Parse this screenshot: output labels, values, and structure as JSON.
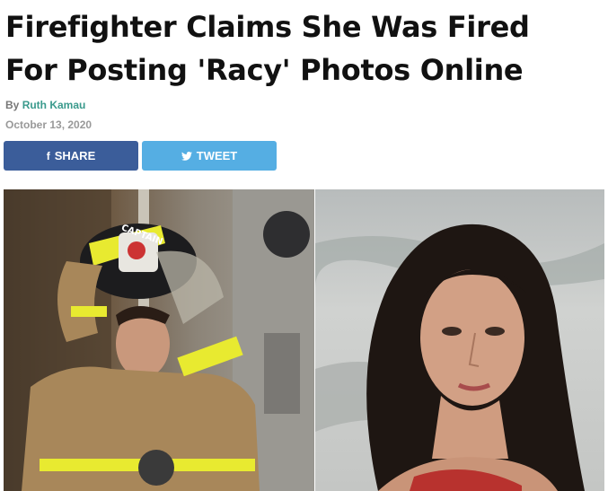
{
  "article": {
    "headline_line1": "Firefighter Claims She Was Fired",
    "headline_line2": "For Posting 'Racy' Photos Online",
    "byline_prefix": "By",
    "author": "Ruth Kamau",
    "date": "October 13, 2020"
  },
  "share": {
    "facebook_icon": "f",
    "facebook_label": "SHARE",
    "twitter_icon": "🐦",
    "twitter_label": "TWEET"
  },
  "photos": {
    "left_helmet_text": "CAPTAIN"
  },
  "colors": {
    "facebook": "#3b5d9a",
    "twitter": "#55aee3",
    "author_link": "#3a9a8c"
  }
}
